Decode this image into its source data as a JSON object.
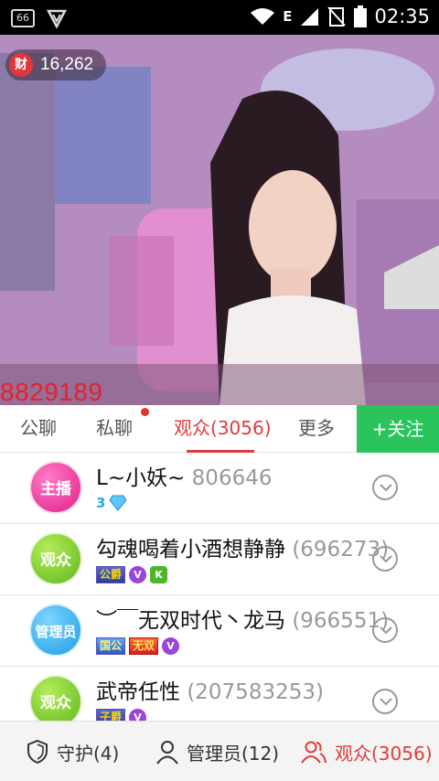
{
  "status_bar": {
    "badge": "66",
    "network": "E",
    "time": "02:35"
  },
  "video": {
    "coin_icon": "财",
    "coin_value": "16,262",
    "room_id": "8829189"
  },
  "tabs": {
    "public_chat": "公聊",
    "private_chat": "私聊",
    "audience": "观众(3056)",
    "more": "更多",
    "follow": "+关注"
  },
  "users": [
    {
      "role": "主播",
      "name": "L~小妖~",
      "id": "806646",
      "badges": {
        "level": "3"
      }
    },
    {
      "role": "观众",
      "name": "勾魂喝着小酒想静静",
      "id": "(696273)",
      "badges": {
        "rank": "公爵",
        "v": "V",
        "k": "K"
      }
    },
    {
      "role": "管理员",
      "name": "︶￣无双时代丶龙马",
      "id": "(966551)",
      "badges": {
        "rank1": "国公",
        "rank2": "无双",
        "v": "V"
      }
    },
    {
      "role": "观众",
      "name": "武帝任性",
      "id": "(207583253)",
      "badges": {
        "rank": "子爵",
        "v": "V"
      }
    }
  ],
  "bottom_bar": {
    "guard": "守护(4)",
    "admins": "管理员(12)",
    "audience": "观众(3056)"
  },
  "colors": {
    "accent": "#e23a3a",
    "follow_bg": "#2bc45c"
  },
  "icons": [
    "shield-icon",
    "person-icon",
    "people-icon",
    "chevron-down-icon",
    "wifi-icon",
    "signal-icon",
    "battery-icon"
  ]
}
